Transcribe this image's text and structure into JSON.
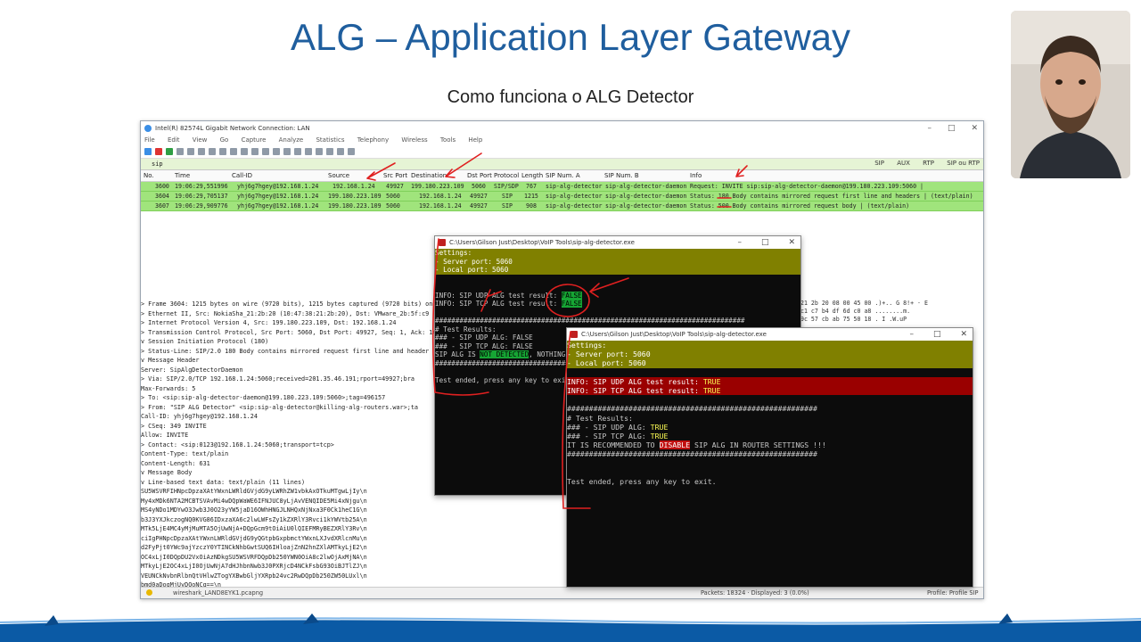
{
  "slide": {
    "title": "ALG – Application Layer Gateway",
    "subtitle": "Como funciona o ALG Detector"
  },
  "wireshark": {
    "window_title": "Intel(R) 82574L Gigabit Network Connection: LAN",
    "menu": [
      "File",
      "Edit",
      "View",
      "Go",
      "Capture",
      "Analyze",
      "Statistics",
      "Telephony",
      "Wireless",
      "Tools",
      "Help"
    ],
    "filter_value": "sip",
    "filter_buttons": [
      "SIP",
      "AUX",
      "RTP",
      "SIP ou RTP"
    ],
    "columns": [
      "No.",
      "Time",
      "Call-ID",
      "Source",
      "Src Port",
      "Destination",
      "Dst Port",
      "Protocol",
      "Length",
      "SIP Num. A",
      "SIP Num. B",
      "Info"
    ],
    "packets": [
      {
        "no": "3600",
        "time": "19:06:29,551996",
        "callid": "yhj6g7hgey@192.168.1.24",
        "src": "192.168.1.24",
        "sport": "49927",
        "dst": "199.180.223.109",
        "dport": "5060",
        "proto": "SIP/SDP",
        "len": "767",
        "a": "sip-alg-detector",
        "b": "sip-alg-detector-daemon",
        "info": "Request: INVITE sip:sip-alg-detector-daemon@199.180.223.109:5060 |"
      },
      {
        "no": "3604",
        "time": "19:06:29,705137",
        "callid": "yhj6g7hgey@192.168.1.24",
        "src": "199.180.223.109",
        "sport": "5060",
        "dst": "192.168.1.24",
        "dport": "49927",
        "proto": "SIP",
        "len": "1215",
        "a": "sip-alg-detector",
        "b": "sip-alg-detector-daemon",
        "info": "Status: 180 Body contains mirrored request first line and headers |  (text/plain)"
      },
      {
        "no": "3607",
        "time": "19:06:29,909776",
        "callid": "yhj6g7hgey@192.168.1.24",
        "src": "199.180.223.109",
        "sport": "5060",
        "dst": "192.168.1.24",
        "dport": "49927",
        "proto": "SIP",
        "len": "908",
        "a": "sip-alg-detector",
        "b": "sip-alg-detector-daemon",
        "info": "Status: 500 Body contains mirrored request body |  (text/plain)"
      }
    ],
    "detail_lines": [
      "> Frame 3604: 1215 bytes on wire (9720 bits), 1215 bytes captured (9720 bits) on",
      "> Ethernet II, Src: NokiaSha_21:2b:20 (10:47:38:21:2b:20), Dst: VMware_2b:5f:c9 (",
      "> Internet Protocol Version 4, Src: 199.180.223.109, Dst: 192.168.1.24",
      "> Transmission Control Protocol, Src Port: 5060, Dst Port: 49927, Seq: 1, Ack: 14",
      "v Session Initiation Protocol (180)",
      "   > Status-Line: SIP/2.0 180 Body contains mirrored request first line and header",
      "   v Message Header",
      "       Server: SipAlgDetectorDaemon",
      "     > Via: SIP/2.0/TCP 192.168.1.24:5060;received=201.35.46.191;rport=49927;bra",
      "       Max-Forwards: 5",
      "     > To: <sip:sip-alg-detector-daemon@199.180.223.109:5060>;tag=496157",
      "     > From: \"SIP ALG Detector\" <sip:sip-alg-detector@killing-alg-routers.war>;ta",
      "       Call-ID: yhj6g7hgey@192.168.1.24",
      "     > CSeq: 349 INVITE",
      "       Allow: INVITE",
      "     > Contact: <sip:0123@192.168.1.24:5060;transport=tcp>",
      "       Content-Type: text/plain",
      "       Content-Length: 631",
      "   v Message Body",
      "     v Line-based text data: text/plain (11 lines)",
      "         SU5WSVRFIHNpcDpzaXAtYWxnLWRldGVjdG9yLWRhZW1vbkAxOTkuMTgwLjIy\\n",
      "         My4xMDk6NTA2MCBTSVAvMi4wDQpWaWE6IFNJUC8yLjAvVENQIDE5Mi4xNjgu\\n",
      "         MS4yNDo1MDYwO3Jwb3J0O23yYW5jaD16OWhHNGJLNHQxNjNxa3F0Ck1heC1G\\n",
      "         b3J3YXJkczogNQ0KVG86IDxzaXA6c2lwLWFsZy1kZXRlY3Rvci1kYWVtb25A\\n",
      "         MTk5LjE4MC4yMjMuMTA5OjUwNjA+DQpGcm9tOiAiU0lQIEFMRyBEZXRlY3Rv\\n",
      "         ciIgPHNpcDpzaXAtYWxnLWRldGVjdG9yQGtpbGxpbmctYWxnLXJvdXRlcnMu\\n",
      "         d2FyPjt0YWc9ajYzczY0YTINCkNhbGwtSUQ6IHloajZnN2hnZXlAMTkyLjE2\\n",
      "         OC4xLjI0DQpDU2VxOiAzNDkgSU5WSVRFDQpDb250YWN0OiA8c2lwOjAxMjNA\\n",
      "         MTkyLjE2OC4xLjI0OjUwNjA7dHJhbnNwb3J0PXRjcD4NCkFsbG93OiBJTlZJ\\n",
      "         VEUNCkNvbnRlbnQtVHlwZTogYXBwbGljYXRpb24vc2RwDQpDb250ZW50LUxl\\n",
      "         bmd0aDogMjUyDQoNCg==\\n"
    ],
    "hex_lines": [
      "9c 57 cb ab 75 50 18    ...",
      "21 2b 20 08 00 45 00   .)+.. G 8!+ · E",
      "c1 c7 b4 df 6d c0 a8   ........m.",
      "9c 57 cb ab 75 50 18   .  I .W.uP"
    ],
    "status_file": "wireshark_LAND8EYK1.pcapng",
    "status_packets": "Packets: 18324 · Displayed: 3 (0.0%)",
    "status_profile": "Profile: Profile SIP"
  },
  "console1": {
    "title": "C:\\Users\\Gilson Just\\Desktop\\VoIP Tools\\sip-alg-detector.exe",
    "settings": [
      "Settings:",
      "- Server port: 5060",
      "- Local port: 5060"
    ],
    "info_udp": "INFO: SIP UDP ALG test result: ",
    "info_tcp": "INFO: SIP TCP ALG test result: ",
    "udp_value": "FALSE",
    "tcp_value": "FALSE",
    "hash_line": "############################################################################",
    "results_title": "#     Test Results:",
    "res_udp": "###   - SIP UDP ALG: FALSE",
    "res_tcp": "###   - SIP TCP ALG: FALSE",
    "alg_prefix": "SIP ALG IS ",
    "alg_status": "NOT DETECTED",
    "alg_suffix": ", NOTHING",
    "ended": "Test ended, press any key to exit."
  },
  "console2": {
    "title": "C:\\Users\\Gilson Just\\Desktop\\VoIP Tools\\sip-alg-detector.exe",
    "settings": [
      "Settings:",
      "- Server port: 5060",
      "- Local port: 5060"
    ],
    "info_udp": "INFO: SIP UDP ALG test result: ",
    "info_tcp": "INFO: SIP TCP ALG test result: ",
    "udp_value": "TRUE",
    "tcp_value": "TRUE",
    "hash_line": "#########################################################",
    "results_title": "#     Test Results:",
    "res_udp_prefix": "###   - SIP UDP ALG: ",
    "res_tcp_prefix": "###   - SIP TCP ALG: ",
    "res_value": "TRUE",
    "rec_prefix": "IT IS RECOMMENDED TO ",
    "rec_word": "DISABLE",
    "rec_suffix": " SIP ALG IN ROUTER SETTINGS !!!",
    "ended": "Test ended, press any key to exit."
  },
  "colors": {
    "title_blue": "#1f5e9e",
    "packet_green": "#a0e47c",
    "settings_olive": "#808000",
    "true_red": "#9a0000",
    "false_green": "#16a534",
    "annotation_red": "#e02020"
  }
}
